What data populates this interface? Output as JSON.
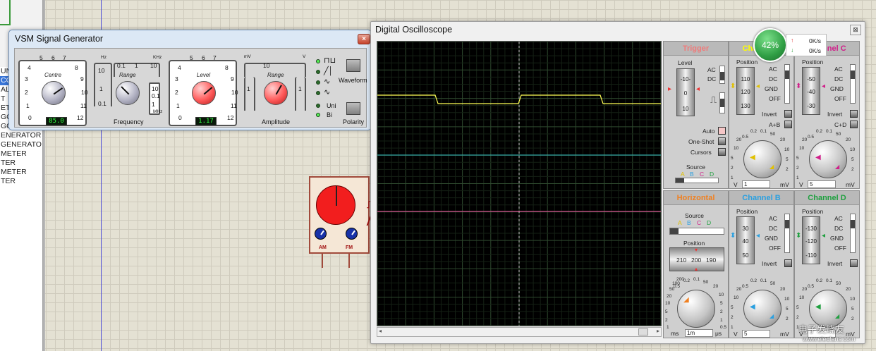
{
  "left_list": {
    "rows": [
      "UN",
      "CO",
      "AL",
      "T",
      "ETER",
      "GG",
      "GG",
      "ENERATOR",
      " GENERATO",
      "METER",
      "TER",
      "METER",
      "TER"
    ],
    "selected_index": 1
  },
  "signal_generator": {
    "title": "VSM Signal Generator",
    "close_label": "×",
    "centre": {
      "label": "Centre",
      "scale": [
        "0",
        "1",
        "2",
        "3",
        "4",
        "5",
        "6",
        "7",
        "8",
        "9",
        "10",
        "11",
        "12"
      ],
      "display": "85.0"
    },
    "range_freq": {
      "label": "Range",
      "units_top": [
        "Hz",
        "KHz"
      ],
      "unit_bottom": "MHz",
      "scale": [
        "10",
        "0.1",
        "1",
        "10",
        "1",
        "10",
        "0.1",
        "0.1",
        "1"
      ]
    },
    "frequency_caption": "Frequency",
    "level": {
      "label": "Level",
      "scale": [
        "0",
        "1",
        "2",
        "3",
        "4",
        "5",
        "6",
        "7",
        "8",
        "9",
        "10",
        "11",
        "12"
      ],
      "display": "1.17"
    },
    "range_amp": {
      "label": "Range",
      "units_top": [
        "mV",
        "V"
      ],
      "scale": [
        "10",
        "1",
        "1"
      ]
    },
    "amplitude_caption": "Amplitude",
    "waveform_label": "Waveform",
    "polarity": {
      "uni": "Uni",
      "bi": "Bi",
      "label": "Polarity"
    },
    "accent": "#ff5a5a"
  },
  "component": {
    "am_label": "AM",
    "fm_label": "FM"
  },
  "oscilloscope": {
    "title": "Digital Oscilloscope",
    "close_label": "⊠",
    "trigger": {
      "title": "Trigger",
      "level_label": "Level",
      "level_scale": [
        "-10-",
        "0",
        "10"
      ],
      "ac": "AC",
      "dc": "DC",
      "auto": "Auto",
      "one_shot": "One-Shot",
      "cursors": "Cursors",
      "source_label": "Source",
      "sources": [
        "A",
        "B",
        "C",
        "D"
      ]
    },
    "channel_a": {
      "title": "Channel A",
      "position_label": "Position",
      "drum": [
        "110",
        "120",
        "130"
      ],
      "coupling": [
        "AC",
        "DC",
        "GND",
        "OFF"
      ],
      "invert": "Invert",
      "extra": "A+B",
      "dial_ticks": [
        "0.5",
        "0.2",
        "0.1",
        "50",
        "20",
        "10",
        "5",
        "2",
        "1",
        "2",
        "5",
        "10",
        "20"
      ],
      "unit_left": "V",
      "unit_value": "1",
      "unit_right": "mV"
    },
    "channel_c": {
      "title": "Channel C",
      "position_label": "Position",
      "drum": [
        "-50",
        "-40",
        "-30"
      ],
      "coupling": [
        "AC",
        "DC",
        "GND",
        "OFF"
      ],
      "invert": "Invert",
      "extra": "C+D",
      "dial_ticks": [
        "0.5",
        "0.2",
        "0.1",
        "50",
        "20",
        "10",
        "5",
        "2",
        "1",
        "2",
        "5",
        "10",
        "20"
      ],
      "unit_left": "V",
      "unit_value": "5",
      "unit_right": "mV"
    },
    "horizontal": {
      "title": "Horizontal",
      "source_label": "Source",
      "sources": [
        "A",
        "B",
        "C",
        "D"
      ],
      "position_label": "Position",
      "position_values": [
        "210",
        "200",
        "190"
      ],
      "dial_ticks": [
        "0.5",
        "0.2",
        "0.1",
        "50",
        "20",
        "10",
        "5",
        "2",
        "1",
        "0.5",
        "1",
        "2",
        "5",
        "10",
        "20",
        "50",
        "100",
        "200"
      ],
      "unit_left": "ms",
      "unit_value": "1m",
      "unit_right": "μs"
    },
    "channel_b": {
      "title": "Channel B",
      "position_label": "Position",
      "drum": [
        "30",
        "40",
        "50"
      ],
      "coupling": [
        "AC",
        "DC",
        "GND",
        "OFF"
      ],
      "invert": "Invert",
      "dial_ticks": [
        "0.5",
        "0.2",
        "0.1",
        "50",
        "20",
        "10",
        "5",
        "2",
        "1",
        "2",
        "5",
        "10",
        "20"
      ],
      "unit_left": "V",
      "unit_value": "5",
      "unit_right": "mV"
    },
    "channel_d": {
      "title": "Channel D",
      "position_label": "Position",
      "drum": [
        "-130",
        "-120",
        "-110"
      ],
      "coupling": [
        "AC",
        "DC",
        "GND",
        "OFF"
      ],
      "invert": "Invert",
      "dial_ticks": [
        "0.5",
        "0.2",
        "0.1",
        "50",
        "20",
        "10",
        "5",
        "2",
        "1",
        "2",
        "5",
        "10",
        "20"
      ],
      "unit_left": "V",
      "unit_value": "",
      "unit_right": "mV"
    },
    "colors": {
      "trace_a": "#ffff55",
      "trace_b": "#39c7c7",
      "trace_c": "#ff55aa",
      "trace_d": "#55ff55",
      "trigger_title": "#f07a7a",
      "a_title": "#ffff00",
      "b_title": "#2aa0e0",
      "c_title": "#d0208a",
      "d_title": "#20a040",
      "h_title": "#f08020"
    }
  },
  "perf_widget": {
    "percent": "42%",
    "up": "0K/s",
    "down": "0K/s"
  },
  "watermark": {
    "brand": "电子发烧友",
    "url": "www.elecfans.com"
  }
}
